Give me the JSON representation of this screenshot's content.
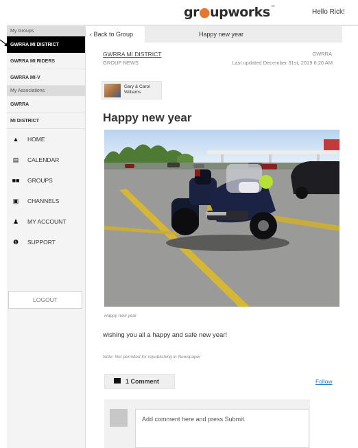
{
  "header": {
    "logo_pre": "gr",
    "logo_dot": "●",
    "logo_post": "upworks",
    "logo_tm": "™",
    "greeting": "Hello Rick!"
  },
  "sidebar": {
    "my_groups_label": "My Groups",
    "groups": [
      "GWRRA MI DISTRICT",
      "GWRRA MI RIDERS",
      "GWRRA MI-V"
    ],
    "my_associations_label": "My Associations",
    "associations": [
      "GWRRA",
      "MI DISTRICT"
    ],
    "nav": [
      {
        "label": "HOME",
        "icon": "home-icon"
      },
      {
        "label": "CALENDAR",
        "icon": "calendar-icon"
      },
      {
        "label": "GROUPS",
        "icon": "groups-icon"
      },
      {
        "label": "CHANNELS",
        "icon": "channels-icon"
      },
      {
        "label": "MY ACCOUNT",
        "icon": "account-icon"
      },
      {
        "label": "SUPPORT",
        "icon": "support-icon"
      }
    ],
    "logout_label": "LOGOUT"
  },
  "crumb": {
    "back_label": "Back to Group",
    "title": "Happy new year"
  },
  "post": {
    "group_name": "GWRRA MI DISTRICT",
    "group_sub": "GROUP NEWS",
    "group_tag": "GWRRA",
    "updated": "Last updated December 31st, 2019 6:20 AM",
    "author": "Gary & Carol Williams",
    "title": "Happy new year",
    "caption": "Happy new year",
    "body": "wishing you all a happy and safe new year!",
    "note": "Note: Not permited for republishing in Newspaper"
  },
  "comments": {
    "count_label": "1 Comment",
    "follow_label": "Follow",
    "input_placeholder": "Add comment here and press Submit."
  },
  "colors": {
    "active_group_bg": "#000000",
    "link": "#2c7ec2",
    "logo_dot": "#e8772e"
  }
}
